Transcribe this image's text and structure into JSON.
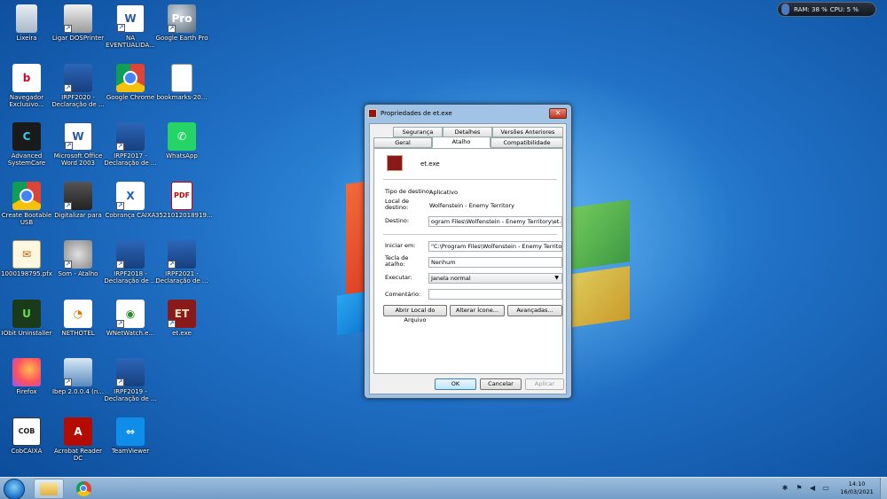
{
  "desktop": {
    "icons": [
      {
        "label": "Lixeira",
        "icon": "recycle-bin-icon",
        "glyph": "",
        "col": 0,
        "row": 0,
        "cls": "i-trash",
        "shortcut": false
      },
      {
        "label": "Ligar DOSPrinter",
        "icon": "printer-icon",
        "glyph": "",
        "col": 1,
        "row": 0,
        "cls": "i-printer",
        "shortcut": true
      },
      {
        "label": "NA EVENTUALIDA...",
        "icon": "word-document-icon",
        "glyph": "W",
        "col": 2,
        "row": 0,
        "cls": "i-word",
        "shortcut": true
      },
      {
        "label": "Google Earth Pro",
        "icon": "google-earth-icon",
        "glyph": "Pro",
        "col": 3,
        "row": 0,
        "cls": "i-earth",
        "shortcut": true
      },
      {
        "label": "Navegador Exclusivo...",
        "icon": "bradesco-icon",
        "glyph": "b",
        "col": 0,
        "row": 1,
        "cls": "i-bradesco",
        "shortcut": false
      },
      {
        "label": "IRPF2020 - Declaração de ...",
        "icon": "irpf-icon",
        "glyph": "",
        "col": 1,
        "row": 1,
        "cls": "i-irpf",
        "shortcut": true
      },
      {
        "label": "Google Chrome",
        "icon": "chrome-icon",
        "glyph": "",
        "col": 2,
        "row": 1,
        "cls": "i-chrome",
        "shortcut": false
      },
      {
        "label": "bookmarks-20...",
        "icon": "file-icon",
        "glyph": "",
        "col": 3,
        "row": 1,
        "cls": "i-file",
        "shortcut": false
      },
      {
        "label": "Advanced SystemCare",
        "icon": "advanced-systemcare-icon",
        "glyph": "C",
        "col": 0,
        "row": 2,
        "cls": "i-asc",
        "shortcut": false
      },
      {
        "label": "Microsoft Office Word 2003",
        "icon": "word-icon",
        "glyph": "W",
        "col": 1,
        "row": 2,
        "cls": "i-word",
        "shortcut": true
      },
      {
        "label": "IRPF2017 - Declaração de ...",
        "icon": "irpf-icon",
        "glyph": "",
        "col": 2,
        "row": 2,
        "cls": "i-irpf",
        "shortcut": true
      },
      {
        "label": "WhatsApp",
        "icon": "whatsapp-icon",
        "glyph": "✆",
        "col": 3,
        "row": 2,
        "cls": "i-whatsapp",
        "shortcut": false
      },
      {
        "label": "Create Bootable USB",
        "icon": "chrome-icon",
        "glyph": "",
        "col": 0,
        "row": 3,
        "cls": "i-chrome",
        "shortcut": false
      },
      {
        "label": "Digitalizar para",
        "icon": "scanner-icon",
        "glyph": "",
        "col": 1,
        "row": 3,
        "cls": "i-scanner",
        "shortcut": true
      },
      {
        "label": "Cobrança CAIXA",
        "icon": "caixa-icon",
        "glyph": "X",
        "col": 2,
        "row": 3,
        "cls": "i-caixa",
        "shortcut": true
      },
      {
        "label": "3521012018919...",
        "icon": "pdf-icon",
        "glyph": "PDF",
        "col": 3,
        "row": 3,
        "cls": "i-pdf",
        "shortcut": false
      },
      {
        "label": "1000198795.pfx",
        "icon": "certificate-icon",
        "glyph": "✉",
        "col": 0,
        "row": 4,
        "cls": "i-cert",
        "shortcut": false
      },
      {
        "label": "Som - Atalho",
        "icon": "speaker-icon",
        "glyph": "",
        "col": 1,
        "row": 4,
        "cls": "i-som",
        "shortcut": true
      },
      {
        "label": "IRPF2018 - Declaração de ...",
        "icon": "irpf-icon",
        "glyph": "",
        "col": 2,
        "row": 4,
        "cls": "i-irpf",
        "shortcut": true
      },
      {
        "label": "IRPF2021 - Declaração de ...",
        "icon": "irpf-icon",
        "glyph": "",
        "col": 3,
        "row": 4,
        "cls": "i-irpf",
        "shortcut": true
      },
      {
        "label": "IObit Uninstaller",
        "icon": "iobit-icon",
        "glyph": "U",
        "col": 0,
        "row": 5,
        "cls": "i-iobit",
        "shortcut": false
      },
      {
        "label": "NETHOTEL",
        "icon": "nethotel-icon",
        "glyph": "◔",
        "col": 1,
        "row": 5,
        "cls": "i-nethotel",
        "shortcut": false
      },
      {
        "label": "WNetWatch.e...",
        "icon": "eye-icon",
        "glyph": "◉",
        "col": 2,
        "row": 5,
        "cls": "i-wnc",
        "shortcut": true
      },
      {
        "label": "et.exe",
        "icon": "et-icon",
        "glyph": "ET",
        "col": 3,
        "row": 5,
        "cls": "i-et",
        "shortcut": true
      },
      {
        "label": "Firefox",
        "icon": "firefox-icon",
        "glyph": "",
        "col": 0,
        "row": 6,
        "cls": "i-firefox",
        "shortcut": false
      },
      {
        "label": "Ibep 2.0.0.4 (n...",
        "icon": "ibge-icon",
        "glyph": "",
        "col": 1,
        "row": 6,
        "cls": "i-ibge",
        "shortcut": true
      },
      {
        "label": "IRPF2019 - Declaração de ...",
        "icon": "irpf-icon",
        "glyph": "",
        "col": 2,
        "row": 6,
        "cls": "i-irpf",
        "shortcut": true
      },
      {
        "label": "CobCAIXA",
        "icon": "cobcaixa-icon",
        "glyph": "COB",
        "col": 0,
        "row": 7,
        "cls": "i-cob",
        "shortcut": false
      },
      {
        "label": "Acrobat Reader DC",
        "icon": "acrobat-icon",
        "glyph": "A",
        "col": 1,
        "row": 7,
        "cls": "i-acrobat",
        "shortcut": false
      },
      {
        "label": "TeamViewer",
        "icon": "teamviewer-icon",
        "glyph": "⇔",
        "col": 2,
        "row": 7,
        "cls": "i-teamviewer",
        "shortcut": false
      }
    ]
  },
  "sysmon": {
    "ram": "RAM: 38 %",
    "cpu": "CPU: 5 %"
  },
  "dialog": {
    "title": "Propriedades de et.exe",
    "close": "✕",
    "tabs_top": [
      "Segurança",
      "Detalhes",
      "Versões Anteriores"
    ],
    "tabs_bottom": [
      "Geral",
      "Atalho",
      "Compatibilidade"
    ],
    "active_tab": "Atalho",
    "file_name": "et.exe",
    "tipo_label": "Tipo de destino:",
    "tipo_value": "Aplicativo",
    "local_label": "Local de destino:",
    "local_value": "Wolfenstein - Enemy Territory",
    "destino_label": "Destino:",
    "destino_value": "ogram Files\\Wolfenstein - Enemy Territory\\et.exe\"",
    "iniciar_label": "Iniciar em:",
    "iniciar_value": "\"C:\\Program Files\\Wolfenstein - Enemy Territory\"",
    "tecla_label": "Tecla de atalho:",
    "tecla_value": "Nenhum",
    "executar_label": "Executar:",
    "executar_value": "Janela normal",
    "comentario_label": "Comentário:",
    "comentario_value": "",
    "btn_abrir": "Abrir Local do Arquivo",
    "btn_alterar": "Alterar Ícone...",
    "btn_avancadas": "Avançadas...",
    "btn_ok": "OK",
    "btn_cancelar": "Cancelar",
    "btn_aplicar": "Aplicar"
  },
  "taskbar": {
    "time": "14:10",
    "date": "16/03/2021"
  }
}
